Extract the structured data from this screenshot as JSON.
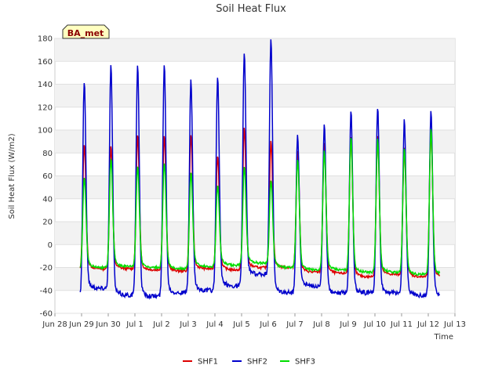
{
  "chart_data": {
    "type": "line",
    "title": "Soil Heat Flux",
    "xlabel": "Time",
    "ylabel": "Soil Heat Flux (W/m2)",
    "badge": "BA_met",
    "xlim": [
      0,
      15
    ],
    "ylim": [
      -60,
      180
    ],
    "yticks": [
      -60,
      -40,
      -20,
      0,
      20,
      40,
      60,
      80,
      100,
      120,
      140,
      160,
      180
    ],
    "xtick_labels": [
      "Jun 28",
      "Jun 29",
      "Jun 30",
      "Jul 1",
      "Jul 2",
      "Jul 3",
      "Jul 4",
      "Jul 5",
      "Jul 6",
      "Jul 7",
      "Jul 8",
      "Jul 9",
      "Jul 10",
      "Jul 11",
      "Jul 12",
      "Jul 13"
    ],
    "x_unit": "days since Jun 28",
    "grid": true,
    "legend_position": "bottom",
    "series": [
      {
        "name": "SHF1",
        "color": "#dd0000",
        "daily_peak_x": [
          1.1,
          2.1,
          3.1,
          4.1,
          5.1,
          6.1,
          7.1,
          8.1,
          9.1,
          10.1,
          11.1,
          12.1,
          13.1,
          14.1
        ],
        "daily_peak": [
          88,
          86,
          96,
          96,
          96,
          78,
          102,
          90,
          82,
          88,
          95,
          95,
          84,
          100
        ],
        "daily_min": [
          -23,
          -21,
          -21,
          -22,
          -23,
          -21,
          -22,
          -20,
          -20,
          -24,
          -25,
          -28,
          -26,
          -28
        ]
      },
      {
        "name": "SHF2",
        "color": "#0000cc",
        "daily_peak_x": [
          1.1,
          2.1,
          3.1,
          4.1,
          5.1,
          6.1,
          7.1,
          8.1,
          9.1,
          10.1,
          11.1,
          12.1,
          13.1,
          14.1
        ],
        "daily_peak": [
          143,
          156,
          158,
          159,
          143,
          146,
          167,
          179,
          96,
          104,
          118,
          120,
          109,
          118
        ],
        "daily_min": [
          -46,
          -38,
          -44,
          -45,
          -42,
          -40,
          -36,
          -26,
          -42,
          -36,
          -42,
          -42,
          -42,
          -44
        ]
      },
      {
        "name": "SHF3",
        "color": "#00dd00",
        "daily_peak_x": [
          1.1,
          2.1,
          3.1,
          4.1,
          5.1,
          6.1,
          7.1,
          8.1,
          9.1,
          10.1,
          11.1,
          12.1,
          13.1,
          14.1
        ],
        "daily_peak": [
          59,
          75,
          69,
          72,
          63,
          52,
          68,
          56,
          74,
          82,
          94,
          92,
          84,
          101
        ],
        "daily_min": [
          -22,
          -20,
          -19,
          -20,
          -21,
          -19,
          -18,
          -16,
          -20,
          -22,
          -22,
          -24,
          -24,
          -26
        ]
      }
    ]
  }
}
